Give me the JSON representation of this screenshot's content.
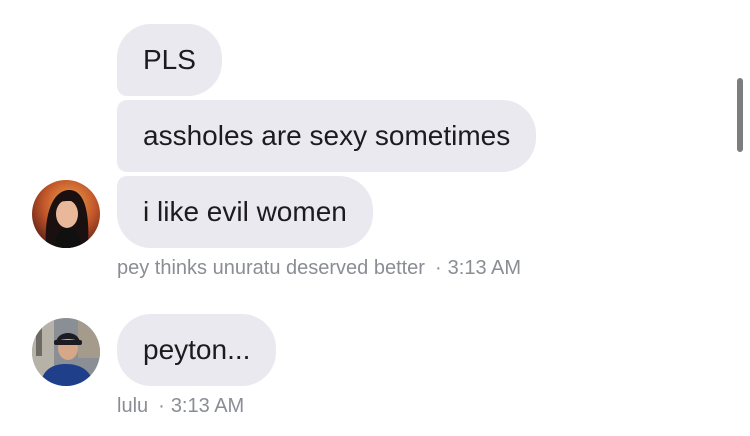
{
  "messages": [
    {
      "text": "PLS"
    },
    {
      "text": "assholes are sexy sometimes"
    },
    {
      "text": "i like evil women"
    },
    {
      "text": "peyton..."
    }
  ],
  "groups": [
    {
      "sender": "pey thinks unuratu deserved better",
      "time": "3:13 AM",
      "avatar": "avatar-dark-hair-woman"
    },
    {
      "sender": "lulu",
      "time": "3:13 AM",
      "avatar": "avatar-man-cap"
    }
  ],
  "separator": "·",
  "colors": {
    "bubble": "#e9e9ef",
    "meta_text": "#8a8d94",
    "message_text": "#1c1c1e"
  }
}
